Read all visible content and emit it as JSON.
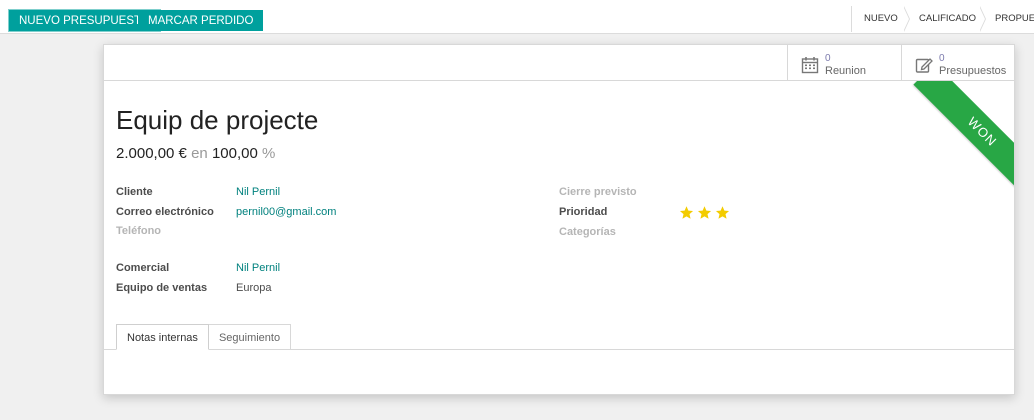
{
  "statusbar": {
    "new_quote_label": "NUEVO PRESUPUESTO",
    "mark_lost_label": "MARCAR PERDIDO",
    "stages": [
      "NUEVO",
      "CALIFICADO",
      "PROPUESTA"
    ]
  },
  "smart_buttons": {
    "meetings": {
      "count": "0",
      "label": "Reunion"
    },
    "quotations": {
      "count": "0",
      "label": "Presupuestos"
    }
  },
  "ribbon": {
    "text": "WON",
    "color": "#28a745"
  },
  "opportunity": {
    "title": "Equip de projecte",
    "expected_revenue": "2.000,00 €",
    "in_word": "en",
    "probability": "100,00",
    "percent_sign": "%"
  },
  "fields": {
    "customer_label": "Cliente",
    "customer_value": "Nil Pernil",
    "email_label": "Correo electrónico",
    "email_value": "pernil00@gmail.com",
    "phone_label": "Teléfono",
    "salesperson_label": "Comercial",
    "salesperson_value": "Nil Pernil",
    "team_label": "Equipo de ventas",
    "team_value": "Europa",
    "deadline_label": "Cierre previsto",
    "priority_label": "Prioridad",
    "priority_value": 3,
    "tags_label": "Categorías"
  },
  "tabs": [
    {
      "label": "Notas internas",
      "active": true
    },
    {
      "label": "Seguimiento",
      "active": false
    }
  ],
  "colors": {
    "accent": "#00a09d",
    "link": "#00817e",
    "star": "#f3cc00"
  }
}
